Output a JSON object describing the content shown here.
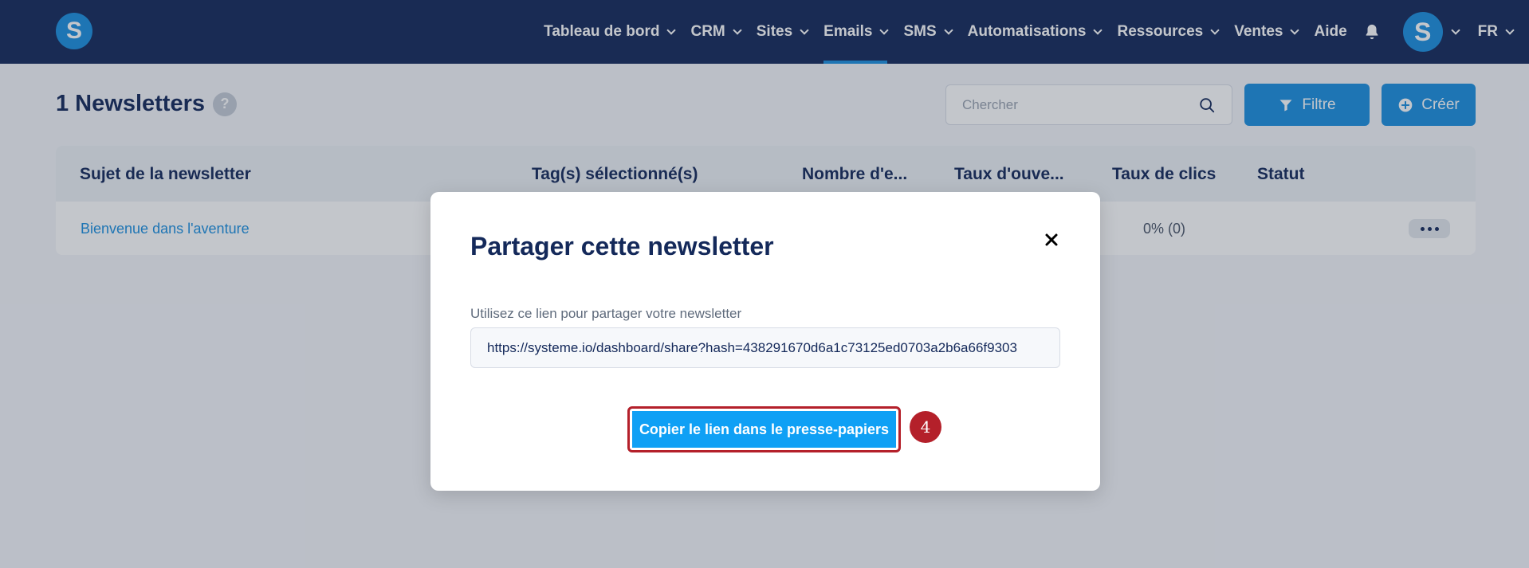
{
  "topbar": {
    "logo": "S",
    "nav": [
      {
        "label": "Tableau de bord"
      },
      {
        "label": "CRM"
      },
      {
        "label": "Sites"
      },
      {
        "label": "Emails"
      },
      {
        "label": "SMS"
      },
      {
        "label": "Automatisations"
      },
      {
        "label": "Ressources"
      },
      {
        "label": "Ventes"
      },
      {
        "label": "Aide"
      }
    ],
    "active_tab": "Emails",
    "avatar": "S",
    "language": "FR"
  },
  "page": {
    "title": "1 Newsletters",
    "help": "?",
    "search_placeholder": "Chercher",
    "filter_label": "Filtre",
    "create_label": "Créer"
  },
  "table": {
    "headers": [
      "Sujet de la newsletter",
      "Tag(s) sélectionné(s)",
      "Nombre d'e...",
      "Taux d'ouve...",
      "Taux de clics",
      "Statut"
    ],
    "rows": [
      {
        "subject": "Bienvenue dans l'aventure",
        "click_rate": "0% (0)"
      }
    ]
  },
  "modal": {
    "title": "Partager cette newsletter",
    "label": "Utilisez ce lien pour partager votre newsletter",
    "link": "https://systeme.io/dashboard/share?hash=438291670d6a1c73125ed0703a2b6a66f9303",
    "copy_button": "Copier le lien dans le presse-papiers",
    "step_marker": "4"
  },
  "colors": {
    "navy": "#14295a",
    "brand_blue": "#1b8fe0",
    "highlight_red": "#b4202a"
  }
}
